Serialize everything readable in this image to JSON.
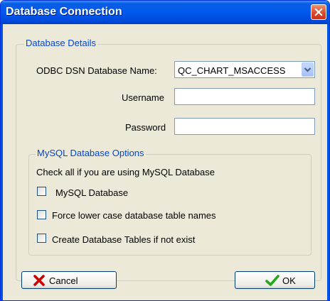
{
  "window": {
    "title": "Database Connection",
    "close_icon": "close-icon"
  },
  "database_details": {
    "legend": "Database Details",
    "odbc_label": "ODBC DSN Database Name:",
    "odbc_value": "QC_CHART_MSACCESS",
    "username_label": "Username",
    "username_value": "",
    "password_label": "Password",
    "password_value": ""
  },
  "mysql_options": {
    "legend": "MySQL Database Options",
    "instruction": "Check all if you are using MySQL Database",
    "checkboxes": [
      {
        "label": "MySQL Database",
        "checked": false
      },
      {
        "label": "Force lower case database table names",
        "checked": false
      },
      {
        "label": "Create Database Tables if not exist",
        "checked": false
      }
    ]
  },
  "buttons": {
    "cancel_label": "Cancel",
    "cancel_icon": "x-icon",
    "ok_label": "OK",
    "ok_icon": "checkmark-icon"
  },
  "colors": {
    "titlebar": "#0058ee",
    "legend_text": "#0046d5",
    "cancel_icon": "#cc0000",
    "ok_icon": "#22a81a"
  }
}
